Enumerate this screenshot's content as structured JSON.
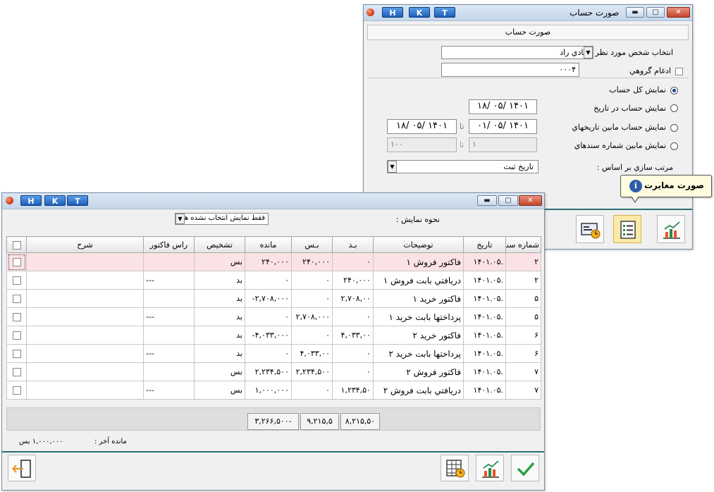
{
  "window1": {
    "title": "صورت حساب",
    "hkt": [
      "H",
      "K",
      "T"
    ],
    "header_label": "صورت حساب",
    "person_label": "انتخاب شخص مورد نظر",
    "person_value": "شادي راد",
    "group_label": "ادغام گروهي",
    "code_value": "۰۰۰۴",
    "options": {
      "all": "نمايش کل حساب",
      "at_date": "نمايش حساب در تاريخ",
      "between_dates": "نمايش حساب مابين تاريخهاي",
      "between_docs": "نمايش مابين شماره سندهاي"
    },
    "date_single": "۱۸/ ۰۵/ ۱۴۰۱",
    "date_from": "۰۱/ ۰۵/ ۱۴۰۱",
    "date_to": "۱۸/ ۰۵/ ۱۴۰۱",
    "to_label": "تا",
    "doc_from": "۱",
    "doc_to": "۱۰۰",
    "sort_label": "مرتب سازي بر اساس :",
    "sort_value": "تاريخ ثبت",
    "tooltip": "صورت مغايرت"
  },
  "window2": {
    "hkt": [
      "H",
      "K",
      "T"
    ],
    "display_label": "نحوه نمايش :",
    "display_value": "فقط نمايش انتخاب نشده ها",
    "columns": [
      "شماره سند",
      "تاريخ",
      "توضيحات",
      "بـد",
      "بـس",
      "مانده",
      "تشخيص",
      "راس فاکتور",
      "شرح"
    ],
    "rows": [
      {
        "doc": "۲",
        "date": "۱۴۰۱.۰۵.",
        "desc": "فاکتور فروش ۱",
        "bed": "۰",
        "bes": "۲۴۰,۰۰۰",
        "mande": "۲۴۰,۰۰۰",
        "tashkhis": "بس",
        "ras": "",
        "sharh": ""
      },
      {
        "doc": "۲",
        "date": "۱۴۰۱.۰۵.",
        "desc": "دريافتي بابت فروش ۱",
        "bed": "۲۴۰,۰۰۰",
        "bes": "۰",
        "mande": "۰",
        "tashkhis": "بد",
        "ras": "---",
        "sharh": ""
      },
      {
        "doc": "۵",
        "date": "۱۴۰۱.۰۵.",
        "desc": "فاکتور خريد ۱",
        "bed": "۲,۷۰۸,۰۰",
        "bes": "۰",
        "mande": "-۲,۷۰۸,۰۰۰",
        "tashkhis": "بد",
        "ras": "",
        "sharh": ""
      },
      {
        "doc": "۵",
        "date": "۱۴۰۱.۰۵.",
        "desc": "پرداختها بابت خريد ۱",
        "bed": "۰",
        "bes": "۲,۷۰۸,۰۰۰",
        "mande": "۰",
        "tashkhis": "بد",
        "ras": "---",
        "sharh": ""
      },
      {
        "doc": "۶",
        "date": "۱۴۰۱.۰۵.",
        "desc": "فاکتور خريد ۲",
        "bed": "۴,۰۳۳,۰۰",
        "bes": "۰",
        "mande": "-۴,۰۳۳,۰۰۰",
        "tashkhis": "بد",
        "ras": "",
        "sharh": ""
      },
      {
        "doc": "۶",
        "date": "۱۴۰۱.۰۵.",
        "desc": "پرداختها بابت خريد ۲",
        "bed": "۰",
        "bes": "۴,۰۳۳,۰۰",
        "mande": "۰",
        "tashkhis": "بد",
        "ras": "---",
        "sharh": ""
      },
      {
        "doc": "۷",
        "date": "۱۴۰۱.۰۵.",
        "desc": "فاکتور فروش ۲",
        "bed": "۰",
        "bes": "۲,۲۳۴,۵۰۰",
        "mande": "۲,۲۳۴,۵۰۰",
        "tashkhis": "بس",
        "ras": "",
        "sharh": ""
      },
      {
        "doc": "۷",
        "date": "۱۴۰۱.۰۵.",
        "desc": "دريافتي بابت فروش ۲",
        "bed": "۱,۲۳۴,۵۰",
        "bes": "۰",
        "mande": "۱,۰۰۰,۰۰۰",
        "tashkhis": "بس",
        "ras": "---",
        "sharh": ""
      }
    ],
    "totals": {
      "bed": "۸,۲۱۵,۵۰",
      "bes": "۹,۲۱۵,۵",
      "mande": "-۳,۲۶۶,۵۰۰"
    },
    "final_label": "مانده آخر :",
    "final_value": "۱,۰۰۰,۰۰۰ بس"
  },
  "colors": {
    "accent_line": "#2a6f74",
    "highlight_row": "#fbe2e4",
    "tooltip_bg": "#fffce0"
  }
}
